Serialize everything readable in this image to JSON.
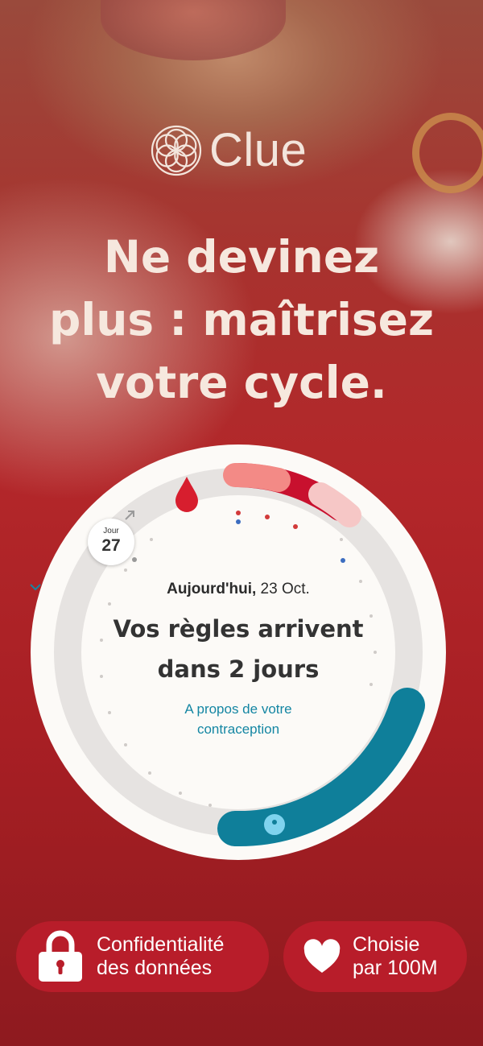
{
  "brand": {
    "name": "Clue",
    "text_color": "#f3e5dc"
  },
  "headline": {
    "line1": "Ne devinez",
    "line2": "plus : maîtrisez",
    "line3": "votre cycle."
  },
  "cycle_card": {
    "day_label": "Jour",
    "day_number": "27",
    "date_bold": "Aujourd'hui,",
    "date_rest": " 23 Oct.",
    "title_line1": "Vos règles arrivent",
    "title_line2": "dans 2 jours",
    "link_line1": "A propos de votre",
    "link_line2": "contraception",
    "period_color": "#c8102e",
    "fertile_color": "#0f7f9a",
    "link_color": "#1486a3"
  },
  "badges": {
    "privacy_line1": "Confidentialité",
    "privacy_line2": "des données",
    "privacy_icon": "lock-icon",
    "chosen_line1": "Choisie",
    "chosen_line2": "par 100M",
    "chosen_icon": "heart-icon",
    "background": "#b81d2a"
  }
}
